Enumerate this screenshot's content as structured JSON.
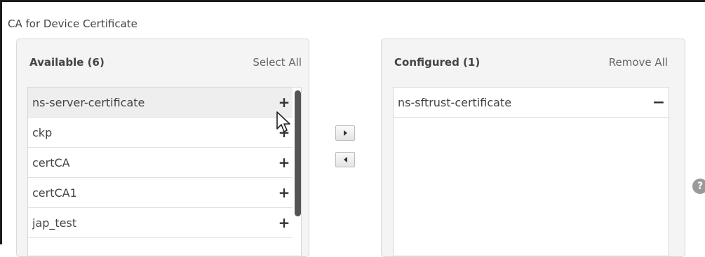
{
  "section": {
    "title": "CA for Device Certificate"
  },
  "available": {
    "title": "Available (6)",
    "action_label": "Select All",
    "items": [
      {
        "label": "ns-server-certificate",
        "action": "+"
      },
      {
        "label": "ckp",
        "action": "+"
      },
      {
        "label": "certCA",
        "action": "+"
      },
      {
        "label": "certCA1",
        "action": "+"
      },
      {
        "label": "jap_test",
        "action": "+"
      }
    ]
  },
  "configured": {
    "title": "Configured (1)",
    "action_label": "Remove All",
    "items": [
      {
        "label": "ns-sftrust-certificate",
        "action": "−"
      }
    ]
  },
  "help": {
    "label": "?"
  },
  "icons": {
    "move_right": "triangle-right-icon",
    "move_left": "triangle-left-icon",
    "help": "question-circle-icon",
    "cursor": "mouse-pointer-icon"
  }
}
